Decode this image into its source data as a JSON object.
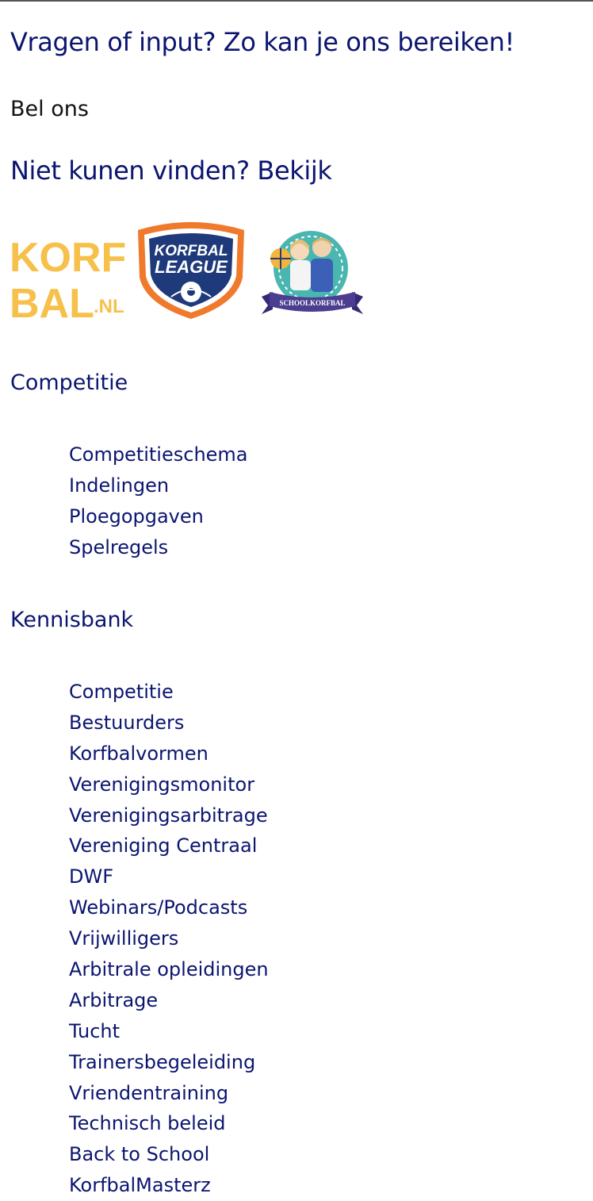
{
  "contact": {
    "heading": "Vragen of input? Zo kan je ons bereiken!",
    "call_label": "Bel ons",
    "not_found": "Niet kunen vinden? Bekijk"
  },
  "logos": {
    "korfbal_nl": {
      "line1": "KORF",
      "line2": "BAL",
      "suffix": ".NL",
      "color": "#f7c04a"
    },
    "korfbal_league": {
      "line1": "KORFBAL",
      "line2": "LEAGUE",
      "shield_color": "#1e3a7a",
      "border_color": "#ef7a2c"
    },
    "schoolkorfbal": {
      "label": "SCHOOLKORFBAL",
      "ribbon_color": "#4b3d8f",
      "circle_color": "#49b7b0"
    }
  },
  "competitie": {
    "title": "Competitie",
    "links": [
      "Competitieschema",
      "Indelingen",
      "Ploegopgaven",
      "Spelregels"
    ]
  },
  "kennisbank": {
    "title": "Kennisbank",
    "links": [
      "Competitie",
      "Bestuurders",
      "Korfbalvormen",
      "Verenigingsmonitor",
      "Verenigingsarbitrage",
      "Vereniging Centraal",
      "DWF",
      "Webinars/Podcasts",
      "Vrijwilligers",
      "Arbitrale opleidingen",
      "Arbitrage",
      "Tucht",
      "Trainersbegeleiding",
      "Vriendentraining",
      "Technisch beleid",
      "Back to School",
      "KorfbalMasterz"
    ]
  }
}
